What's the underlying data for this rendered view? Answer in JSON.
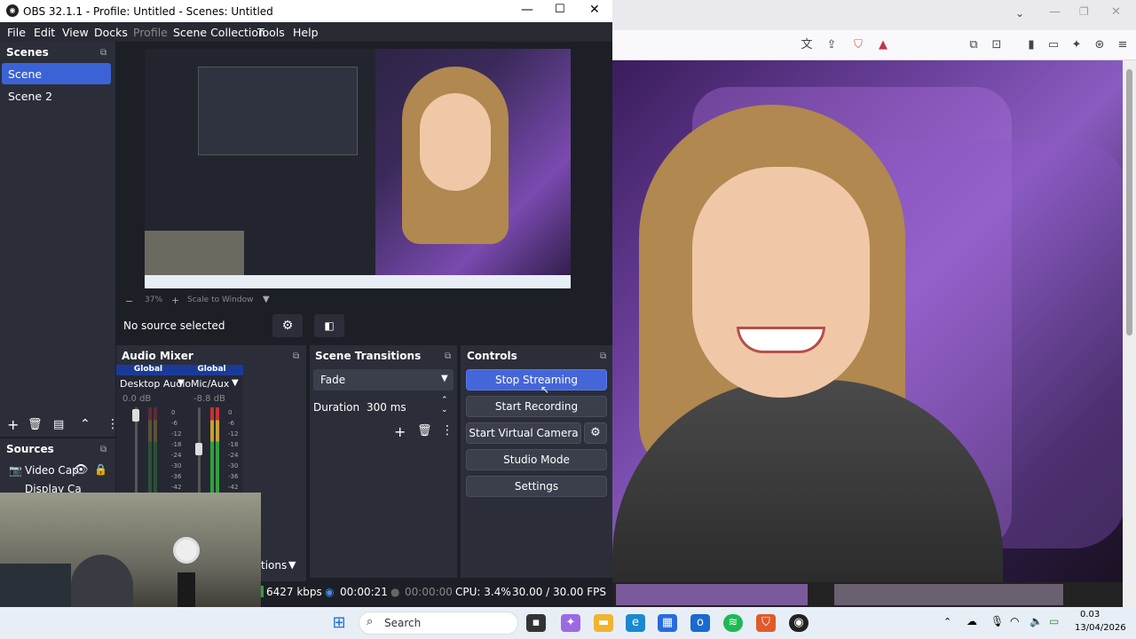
{
  "obs": {
    "window_title": "OBS 32.1.1 - Profile: Untitled - Scenes: Untitled",
    "menu": [
      "File",
      "Edit",
      "View",
      "Docks",
      "Profile",
      "Scene Collection",
      "Tools",
      "Help"
    ],
    "scenes": {
      "title": "Scenes",
      "items": [
        "Scene",
        "Scene 2"
      ],
      "active_index": 0
    },
    "sources": {
      "title": "Sources",
      "items": [
        "Video Cap",
        "Display Ca"
      ]
    },
    "no_source": "No source selected",
    "preview_zoom": "37%",
    "preview_scale": "Scale to Window",
    "audio_mixer": {
      "title": "Audio Mixer",
      "channels": [
        {
          "scope": "Global",
          "name": "Desktop Audio",
          "level": "0.0 dB"
        },
        {
          "scope": "Global",
          "name": "Mic/Aux",
          "level": "-8.8 dB"
        }
      ],
      "scale": [
        "0",
        "-6",
        "-12",
        "-18",
        "-24",
        "-30",
        "-36",
        "-42"
      ]
    },
    "transitions": {
      "title": "Scene Transitions",
      "selected": "Fade",
      "duration_label": "Duration",
      "duration_value": "300 ms"
    },
    "controls": {
      "title": "Controls",
      "stop_streaming": "Stop Streaming",
      "start_recording": "Start Recording",
      "start_virtual_camera": "Start Virtual Camera",
      "studio_mode": "Studio Mode",
      "settings": "Settings"
    },
    "partial_label": "tions",
    "status": {
      "bitrate": "6427 kbps",
      "stream_time": "00:00:21",
      "rec_time": "00:00:00",
      "cpu": "CPU: 3.4%",
      "fps": "30.00 / 30.00 FPS"
    }
  },
  "taskbar": {
    "search_placeholder": "Search",
    "time": "0.03",
    "date": "13/04/2026"
  },
  "colors": {
    "accent": "#4566d8",
    "dock_bg": "#2b2e38",
    "window_bg": "#1d1f26"
  }
}
